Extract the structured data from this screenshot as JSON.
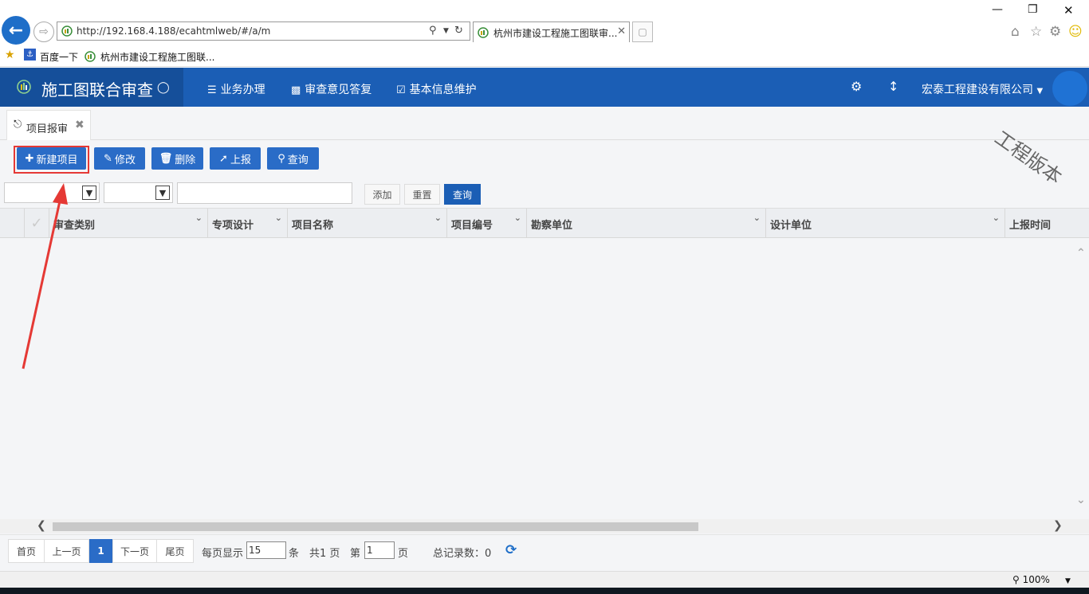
{
  "browser": {
    "url": "http://192.168.4.188/ecahtmlweb/#/a/m",
    "tab_title": "杭州市建设工程施工图联审...",
    "favorites": [
      "百度一下",
      "杭州市建设工程施工图联..."
    ],
    "zoom": "100%"
  },
  "header": {
    "app_title": "施工图联合审查",
    "nav": [
      "业务办理",
      "审查意见答复",
      "基本信息维护"
    ],
    "company": "宏泰工程建设有限公司"
  },
  "page_tab": {
    "label": "项目报审"
  },
  "watermark": "工程版本",
  "toolbar": {
    "new": "新建项目",
    "edit": "修改",
    "delete": "删除",
    "submit": "上报",
    "query": "查询"
  },
  "filter": {
    "add": "添加",
    "reset": "重置",
    "query": "查询"
  },
  "grid": {
    "columns": [
      "审查类别",
      "专项设计",
      "项目名称",
      "项目编号",
      "勘察单位",
      "设计单位",
      "上报时间"
    ]
  },
  "pager": {
    "first": "首页",
    "prev": "上一页",
    "current": "1",
    "next": "下一页",
    "last": "尾页",
    "per_page_label": "每页显示",
    "per_page": "15",
    "unit": "条",
    "total_pages": "共1 页",
    "page_label": "第",
    "page_value": "1",
    "page_suffix": "页",
    "total_records": "总记录数：0"
  },
  "colors": {
    "header": "#1b5eb5",
    "button": "#2a6cc7",
    "highlight": "#e53935"
  }
}
